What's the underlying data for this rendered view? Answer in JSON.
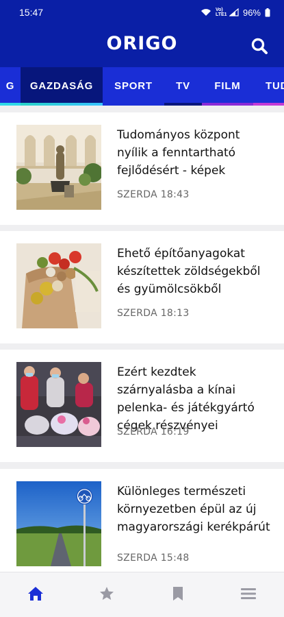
{
  "status": {
    "time": "15:47",
    "network": "Vo) LTE1",
    "battery": "96%"
  },
  "header": {
    "logo": "ORIGO"
  },
  "tabs": [
    {
      "label": "G"
    },
    {
      "label": "GAZDASÁG"
    },
    {
      "label": "SPORT"
    },
    {
      "label": "TV"
    },
    {
      "label": "FILM"
    },
    {
      "label": "TUD"
    }
  ],
  "articles": [
    {
      "title": "Tudományos központ nyílik a fenntartható fejlődésért - képek",
      "time": "SZERDA 18:43"
    },
    {
      "title": "Ehető építőanyagokat készítettek zöldségekből és gyümölcsökből",
      "time": "SZERDA 18:13"
    },
    {
      "title": "Ezért kezdtek szárnyalásba a kínai pelenka- és játékgyártó cégek részvényei",
      "time": "SZERDA 16:19"
    },
    {
      "title": "Különleges természeti környezetben épül az új magyarországi kerékpárút",
      "time": "SZERDA 15:48"
    }
  ],
  "colors": {
    "primary": "#0a1fa6",
    "tabs_bg": "#1a2ed6",
    "active_tab": "#07167c",
    "nav_active": "#1a2ed6",
    "nav_inactive": "#9a9aa4"
  },
  "bottom_nav": [
    {
      "icon": "home-icon",
      "active": true
    },
    {
      "icon": "star-icon",
      "active": false
    },
    {
      "icon": "bookmark-icon",
      "active": false
    },
    {
      "icon": "menu-icon",
      "active": false
    }
  ]
}
